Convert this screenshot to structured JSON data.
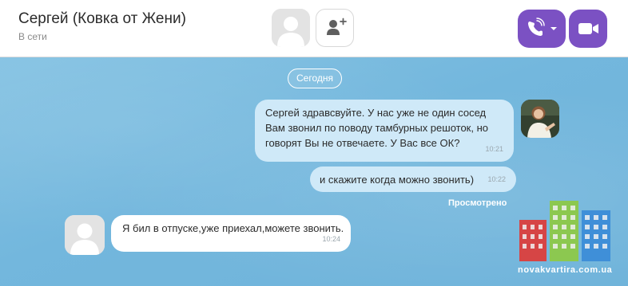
{
  "header": {
    "contact_name": "Сергей (Ковка от Жени)",
    "contact_status": "В сети"
  },
  "icons": {
    "avatar": "person-silhouette-icon",
    "add_contact": "add-contact-icon",
    "voice_call": "phone-call-icon",
    "call_options": "chevron-down-icon",
    "video_call": "video-camera-icon"
  },
  "colors": {
    "accent": "#7b51c3",
    "chat_background": "#79badf",
    "outgoing_bubble": "#cfe9f8",
    "incoming_bubble": "#ffffff"
  },
  "chat": {
    "date_separator": "Сегодня",
    "messages": [
      {
        "direction": "outgoing",
        "text": "Сергей здравсвуйте. У нас уже не один сосед Вам звонил по поводу тамбурных решоток, но говорят Вы не отвечаете. У Вас все ОК?",
        "time": "10:21"
      },
      {
        "direction": "outgoing",
        "text": "и скажите когда можно звонить)",
        "time": "10:22"
      },
      {
        "direction": "incoming",
        "text": "Я бил в отпуске,уже приехал,можете звонить.",
        "time": "10:24"
      }
    ],
    "seen_label": "Просмотрено"
  },
  "watermark": {
    "text": "novakvartira.com.ua"
  }
}
